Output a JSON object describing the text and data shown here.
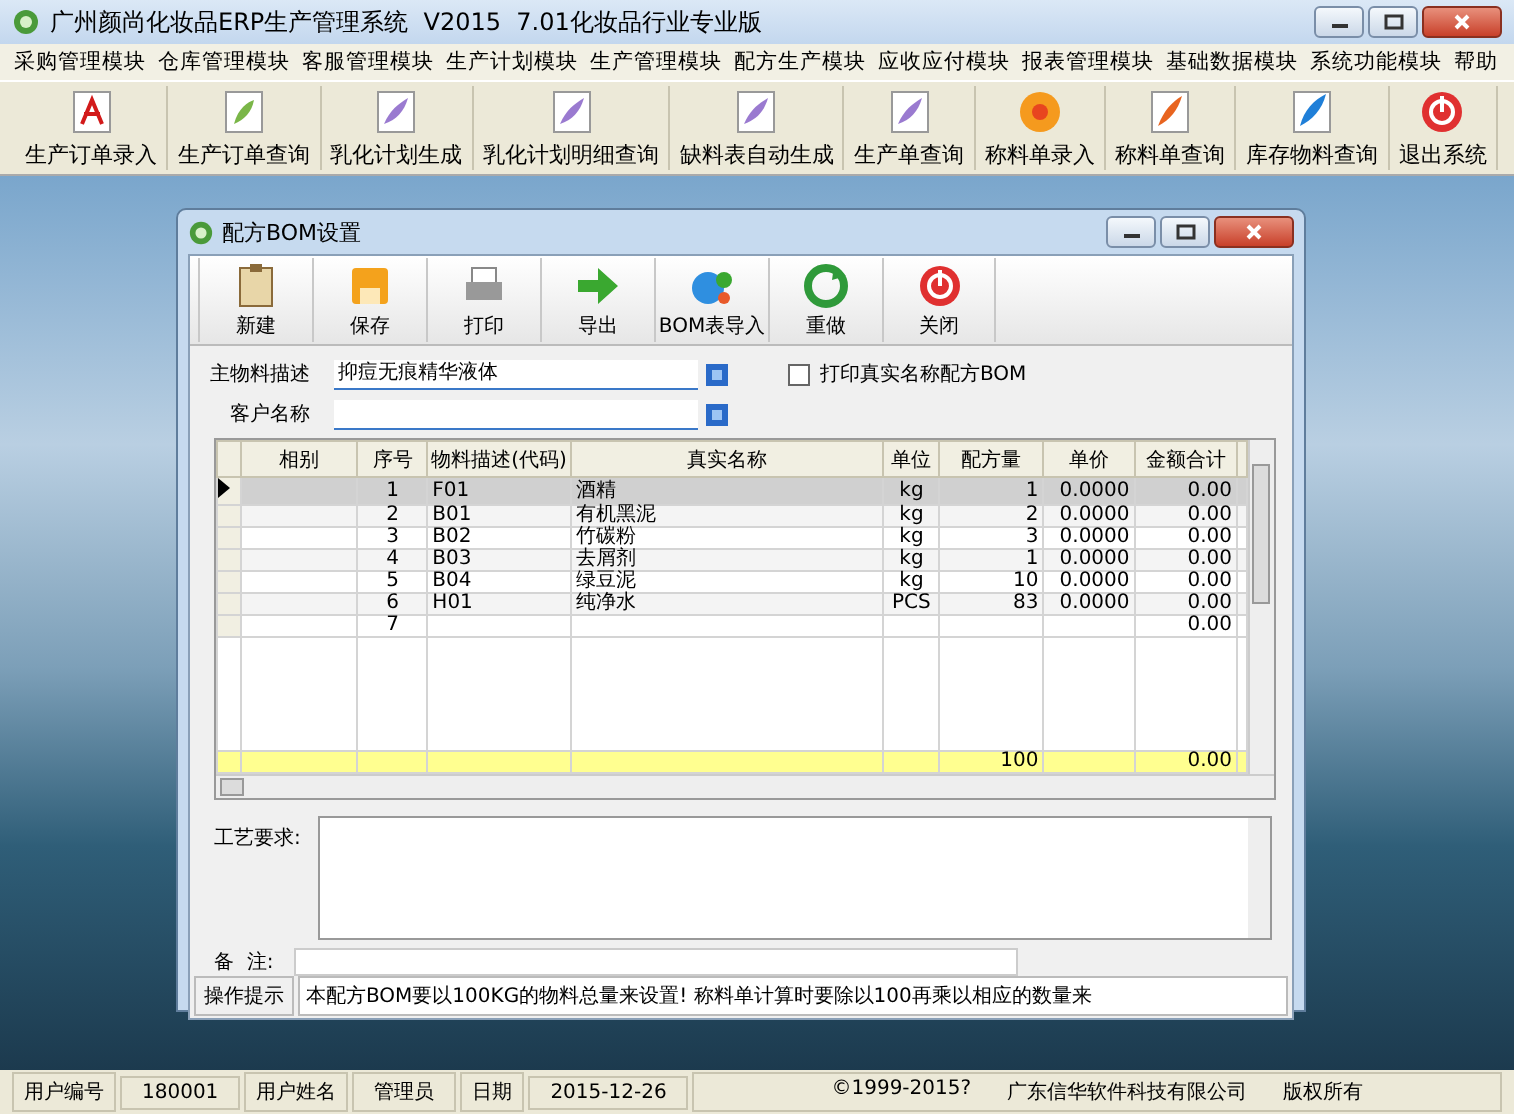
{
  "window": {
    "title": "广州颜尚化妆品ERP生产管理系统  V2015  7.01化妆品行业专业版"
  },
  "menu": [
    "采购管理模块",
    "仓库管理模块",
    "客服管理模块",
    "生产计划模块",
    "生产管理模块",
    "配方生产模块",
    "应收应付模块",
    "报表管理模块",
    "基础数据模块",
    "系统功能模块",
    "帮助"
  ],
  "toolbar": [
    {
      "label": "生产订单录入",
      "kind": "pdf"
    },
    {
      "label": "生产订单查询",
      "kind": "leaf"
    },
    {
      "label": "乳化计划生成",
      "kind": "feather"
    },
    {
      "label": "乳化计划明细查询",
      "kind": "feather"
    },
    {
      "label": "缺料表自动生成",
      "kind": "feather"
    },
    {
      "label": "生产单查询",
      "kind": "feather"
    },
    {
      "label": "称料单录入",
      "kind": "flower"
    },
    {
      "label": "称料单查询",
      "kind": "quill"
    },
    {
      "label": "库存物料查询",
      "kind": "pen"
    },
    {
      "label": "退出系统",
      "kind": "power"
    }
  ],
  "child_window": {
    "title": "配方BOM设置",
    "toolbar": [
      {
        "label": "新建",
        "kind": "clipboard"
      },
      {
        "label": "保存",
        "kind": "floppy"
      },
      {
        "label": "打印",
        "kind": "printer"
      },
      {
        "label": "导出",
        "kind": "arrow"
      },
      {
        "label": "BOM表导入",
        "kind": "import"
      },
      {
        "label": "重做",
        "kind": "redo"
      },
      {
        "label": "关闭",
        "kind": "power"
      }
    ],
    "fields": [
      {
        "label": "主物料描述",
        "value": "抑痘无痕精华液体"
      },
      {
        "label": "客户名称"
      }
    ],
    "print_option": {
      "label": "打印真实名称配方BOM",
      "checked": false
    },
    "table": {
      "columns": [
        "相别",
        "序号",
        "物料描述(代码)",
        "真实名称",
        "单位",
        "配方量",
        "单价",
        "金额合计"
      ],
      "rows": [
        {
          "selected": true,
          "seq": "1",
          "code": "F01",
          "name": "酒精",
          "unit": "kg",
          "qty": "1",
          "price": "0.0000",
          "amount": "0.00"
        },
        {
          "selected": false,
          "seq": "2",
          "code": "B01",
          "name": "有机黑泥",
          "unit": "kg",
          "qty": "2",
          "price": "0.0000",
          "amount": "0.00"
        },
        {
          "selected": false,
          "seq": "3",
          "code": "B02",
          "name": "竹碳粉",
          "unit": "kg",
          "qty": "3",
          "price": "0.0000",
          "amount": "0.00"
        },
        {
          "selected": false,
          "seq": "4",
          "code": "B03",
          "name": "去屑剂",
          "unit": "kg",
          "qty": "1",
          "price": "0.0000",
          "amount": "0.00"
        },
        {
          "selected": false,
          "seq": "5",
          "code": "B04",
          "name": "绿豆泥",
          "unit": "kg",
          "qty": "10",
          "price": "0.0000",
          "amount": "0.00"
        },
        {
          "selected": false,
          "seq": "6",
          "code": "H01",
          "name": "纯净水",
          "unit": "PCS",
          "qty": "83",
          "price": "0.0000",
          "amount": "0.00"
        },
        {
          "selected": false,
          "seq": "7",
          "amount": "0.00"
        }
      ],
      "totals": {
        "qty": "100",
        "amount": "0.00"
      }
    },
    "process": {
      "label": "工艺要求:"
    },
    "remarks": {
      "label": "备  注:"
    },
    "hint": {
      "label": "操作提示",
      "text": "本配方BOM要以100KG的物料总量来设置! 称料单计算时要除以100再乘以相应的数量来"
    }
  },
  "status_bar": [
    "用户编号",
    "180001",
    "用户姓名",
    "管理员",
    "日期",
    "2015-12-26"
  ],
  "copyright": [
    "©1999-2015?",
    "广东信华软件科技有限公司",
    "版权所有"
  ]
}
